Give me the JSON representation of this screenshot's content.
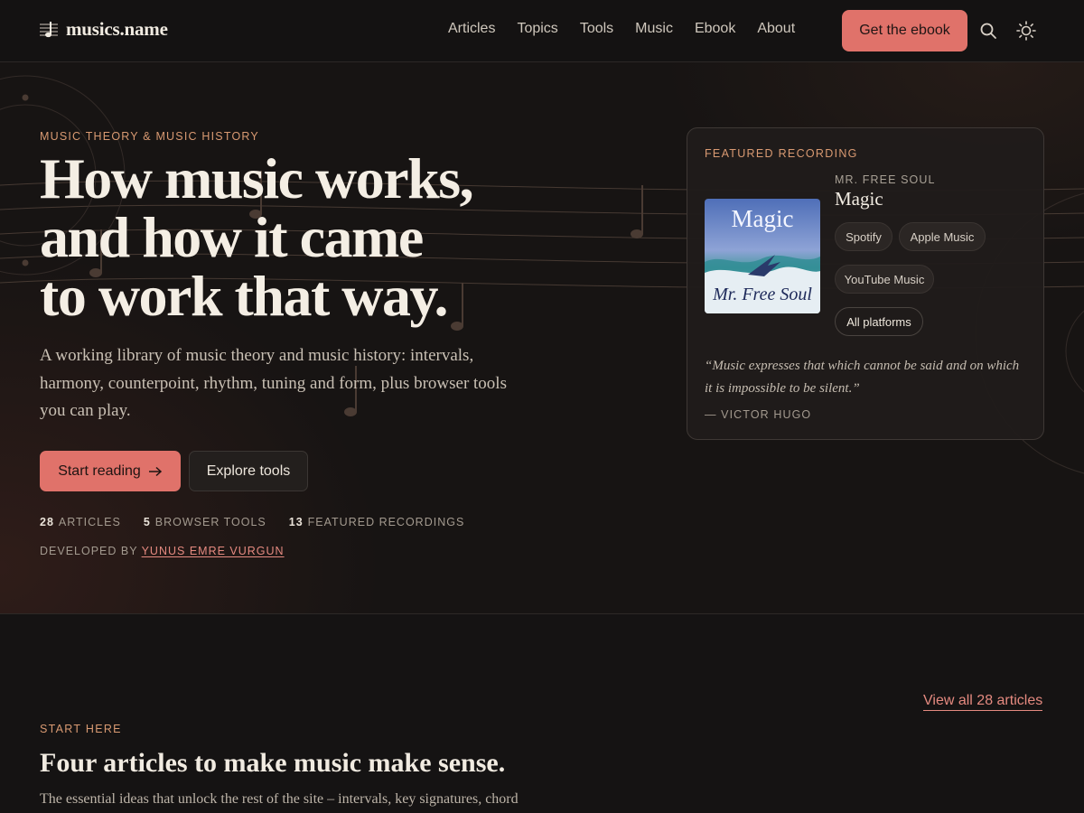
{
  "site": {
    "name": "musics.name"
  },
  "nav": {
    "items": [
      "Articles",
      "Topics",
      "Tools",
      "Music",
      "Ebook",
      "About"
    ]
  },
  "header": {
    "cta_label": "Get the ebook",
    "search_icon": "search-icon",
    "theme_icon": "sun-icon"
  },
  "hero": {
    "eyebrow": "Music theory & music history",
    "title_lines": [
      "How music works,",
      "and how it came",
      "to work that way."
    ],
    "description": "A working library of music theory and music history: intervals, harmony, counterpoint, rhythm, tuning and form, plus browser tools you can play.",
    "start_label": "Start reading",
    "explore_label": "Explore tools",
    "stats": [
      {
        "value": "28",
        "label": "Articles"
      },
      {
        "value": "5",
        "label": "Browser tools"
      },
      {
        "value": "13",
        "label": "Featured recordings"
      }
    ],
    "developed_by_prefix": "Developed by",
    "developer": "Yunus Emre Vurgun"
  },
  "featured": {
    "eyebrow": "Featured recording",
    "artist": "Mr. Free Soul",
    "title": "Magic",
    "album_title_text": "Magic",
    "album_artist_text": "Mr. Free Soul",
    "platforms": [
      "Spotify",
      "Apple Music",
      "YouTube Music",
      "All platforms"
    ],
    "quote": "“Music expresses that which cannot be said and on which it is impossible to be silent.”",
    "quote_author": "— Victor Hugo"
  },
  "start_here": {
    "view_all": "View all 28 articles",
    "eyebrow": "Start here",
    "title": "Four articles to make music make sense.",
    "description": "The essential ideas that unlock the rest of the site – intervals, key signatures, chord"
  },
  "colors": {
    "accent": "#e0726a",
    "eyebrow": "#d99a72",
    "background": "#151313"
  }
}
